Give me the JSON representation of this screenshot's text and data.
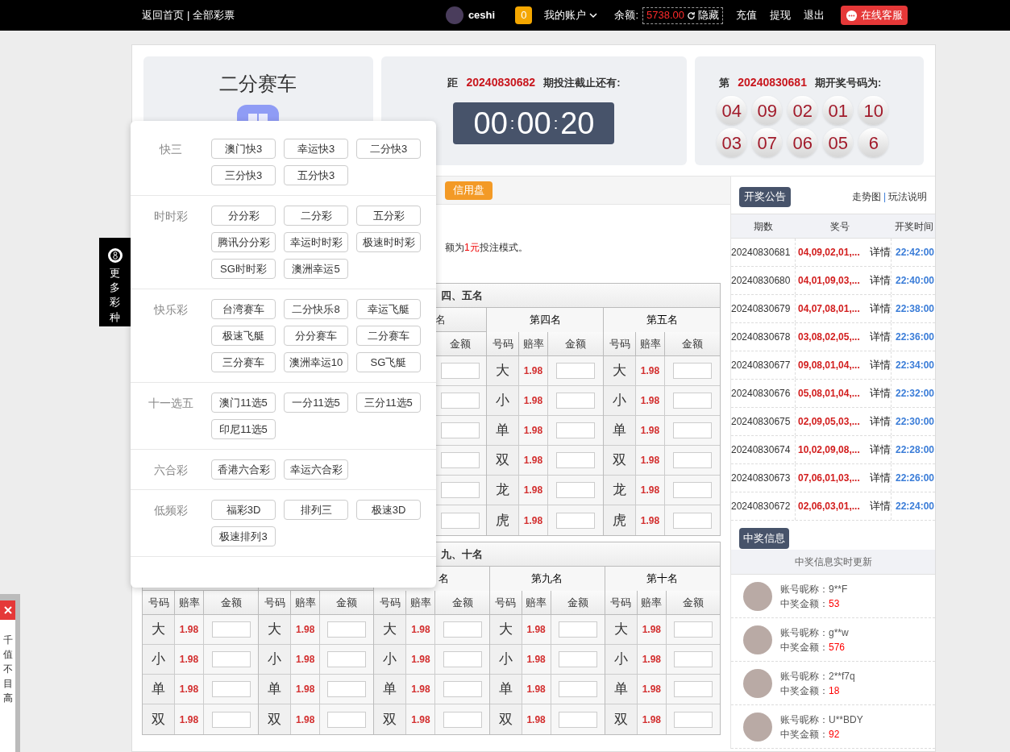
{
  "topbar": {
    "left_links": [
      "返回首页",
      "全部彩票"
    ],
    "separator": "|",
    "username": "ceshi",
    "message_count": "0",
    "account_menu": "我的账户",
    "balance_label": "余额:",
    "balance": "5738.00",
    "hide_link": "隐藏",
    "links": [
      "充值",
      "提现",
      "退出"
    ],
    "service_button": "在线客服"
  },
  "game": {
    "title": "二分赛车"
  },
  "countdown_card": {
    "prefix": "距",
    "issue": "20240830682",
    "suffix": "期投注截止还有:",
    "timer": [
      {
        "kind": "digits",
        "text": "00"
      },
      {
        "kind": "sep",
        "text": ":"
      },
      {
        "kind": "digits",
        "text": "00"
      },
      {
        "kind": "sep",
        "text": ":"
      },
      {
        "kind": "digits",
        "text": "20"
      }
    ]
  },
  "result_card": {
    "prefix": "第",
    "issue": "20240830681",
    "suffix": "期开奖号码为:",
    "balls": [
      "04",
      "09",
      "02",
      "01",
      "10",
      "03",
      "07",
      "06",
      "05",
      "6"
    ]
  },
  "bet_tabs": [
    {
      "label": "信用盘",
      "selected": true
    }
  ],
  "notice": [
    {
      "text": "额为",
      "highlight": false
    },
    {
      "text": "1元",
      "highlight": true
    },
    {
      "text": "投注模式。",
      "highlight": false
    }
  ],
  "table_1": {
    "title": "四、五名",
    "partial_group": {
      "title": "名",
      "header": "金额"
    },
    "groups": [
      {
        "title": "第四名",
        "headers": [
          "号码",
          "赔率",
          "金额"
        ],
        "rows": [
          {
            "code": "大",
            "odds": "1.98"
          },
          {
            "code": "小",
            "odds": "1.98"
          },
          {
            "code": "单",
            "odds": "1.98"
          },
          {
            "code": "双",
            "odds": "1.98"
          },
          {
            "code": "龙",
            "odds": "1.98"
          },
          {
            "code": "虎",
            "odds": "1.98"
          }
        ]
      },
      {
        "title": "第五名",
        "headers": [
          "号码",
          "赔率",
          "金额"
        ],
        "rows": [
          {
            "code": "大",
            "odds": "1.98"
          },
          {
            "code": "小",
            "odds": "1.98"
          },
          {
            "code": "单",
            "odds": "1.98"
          },
          {
            "code": "双",
            "odds": "1.98"
          },
          {
            "code": "龙",
            "odds": "1.98"
          },
          {
            "code": "虎",
            "odds": "1.98"
          }
        ]
      }
    ]
  },
  "table_2": {
    "title": "九、十名",
    "groups": [
      {
        "headers": [
          "号码",
          "赔率",
          "金额"
        ],
        "rows": [
          {
            "code": "大",
            "odds": "1.98"
          },
          {
            "code": "小",
            "odds": "1.98"
          },
          {
            "code": "单",
            "odds": "1.98"
          },
          {
            "code": "双",
            "odds": "1.98"
          }
        ]
      },
      {
        "headers": [
          "号码",
          "赔率",
          "金额"
        ],
        "rows": [
          {
            "code": "大",
            "odds": "1.98"
          },
          {
            "code": "小",
            "odds": "1.98"
          },
          {
            "code": "单",
            "odds": "1.98"
          },
          {
            "code": "双",
            "odds": "1.98"
          }
        ]
      },
      {
        "title": "名",
        "cut_off": true,
        "headers": [
          "号码",
          "赔率",
          "金额"
        ],
        "rows": [
          {
            "code": "大",
            "odds": "1.98"
          },
          {
            "code": "小",
            "odds": "1.98"
          },
          {
            "code": "单",
            "odds": "1.98"
          },
          {
            "code": "双",
            "odds": "1.98"
          }
        ]
      },
      {
        "title": "第九名",
        "headers": [
          "号码",
          "赔率",
          "金额"
        ],
        "rows": [
          {
            "code": "大",
            "odds": "1.98"
          },
          {
            "code": "小",
            "odds": "1.98"
          },
          {
            "code": "单",
            "odds": "1.98"
          },
          {
            "code": "双",
            "odds": "1.98"
          }
        ]
      },
      {
        "title": "第十名",
        "headers": [
          "号码",
          "赔率",
          "金额"
        ],
        "rows": [
          {
            "code": "大",
            "odds": "1.98"
          },
          {
            "code": "小",
            "odds": "1.98"
          },
          {
            "code": "单",
            "odds": "1.98"
          },
          {
            "code": "双",
            "odds": "1.98"
          }
        ]
      }
    ]
  },
  "more_games_tab": {
    "label": "更多彩种"
  },
  "game_menu": {
    "sections": [
      {
        "name": "快三",
        "items": [
          "澳门快3",
          "幸运快3",
          "二分快3",
          "三分快3",
          "五分快3"
        ]
      },
      {
        "name": "时时彩",
        "items": [
          "分分彩",
          "二分彩",
          "五分彩",
          "腾讯分分彩",
          "幸运时时彩",
          "极速时时彩",
          "SG时时彩",
          "澳洲幸运5"
        ]
      },
      {
        "name": "快乐彩",
        "items": [
          "台湾赛车",
          "二分快乐8",
          "幸运飞艇",
          "极速飞艇",
          "分分赛车",
          "二分赛车",
          "三分赛车",
          "澳洲幸运10",
          "SG飞艇"
        ]
      },
      {
        "name": "十一选五",
        "items": [
          "澳门11选5",
          "一分11选5",
          "三分11选5",
          "印尼11选5"
        ]
      },
      {
        "name": "六合彩",
        "items": [
          "香港六合彩",
          "幸运六合彩"
        ]
      },
      {
        "name": "低频彩",
        "items": [
          "福彩3D",
          "排列三",
          "极速3D",
          "极速排列3"
        ]
      }
    ]
  },
  "results_panel": {
    "tab": "开奖公告",
    "links": [
      "走势图",
      "玩法说明"
    ],
    "link_separator": "|",
    "columns": [
      "期数",
      "奖号",
      "开奖时间"
    ],
    "rows": [
      {
        "issue": "20240830681",
        "numbers": "04,09,02,01,...",
        "detail": "详情",
        "time": "22:42:00"
      },
      {
        "issue": "20240830680",
        "numbers": "04,01,09,03,...",
        "detail": "详情",
        "time": "22:40:00"
      },
      {
        "issue": "20240830679",
        "numbers": "04,07,08,01,...",
        "detail": "详情",
        "time": "22:38:00"
      },
      {
        "issue": "20240830678",
        "numbers": "03,08,02,05,...",
        "detail": "详情",
        "time": "22:36:00"
      },
      {
        "issue": "20240830677",
        "numbers": "09,08,01,04,...",
        "detail": "详情",
        "time": "22:34:00"
      },
      {
        "issue": "20240830676",
        "numbers": "05,08,01,04,...",
        "detail": "详情",
        "time": "22:32:00"
      },
      {
        "issue": "20240830675",
        "numbers": "02,09,05,03,...",
        "detail": "详情",
        "time": "22:30:00"
      },
      {
        "issue": "20240830674",
        "numbers": "10,02,09,08,...",
        "detail": "详情",
        "time": "22:28:00"
      },
      {
        "issue": "20240830673",
        "numbers": "07,06,01,03,...",
        "detail": "详情",
        "time": "22:26:00"
      },
      {
        "issue": "20240830672",
        "numbers": "02,06,03,01,...",
        "detail": "详情",
        "time": "22:24:00"
      }
    ]
  },
  "winners_panel": {
    "tab": "中奖信息",
    "subtitle": "中奖信息实时更新",
    "entries": [
      {
        "name_label": "账号昵称：",
        "name": "9**F",
        "amount_label": "中奖金额：",
        "amount": "53"
      },
      {
        "name_label": "账号昵称：",
        "name": "g**w",
        "amount_label": "中奖金额：",
        "amount": "576"
      },
      {
        "name_label": "账号昵称：",
        "name": "2**f7q",
        "amount_label": "中奖金额：",
        "amount": "18"
      },
      {
        "name_label": "账号昵称：",
        "name": "U**BDY",
        "amount_label": "中奖金额：",
        "amount": "92"
      }
    ]
  },
  "side_notice": {
    "lines": [
      "千",
      "值",
      "不",
      "目",
      "高"
    ]
  }
}
